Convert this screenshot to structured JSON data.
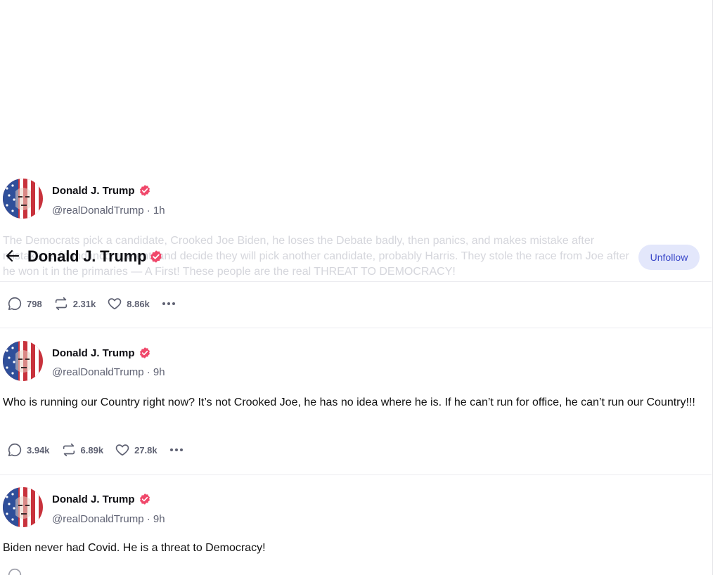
{
  "header": {
    "title": "Donald J. Trump",
    "unfollow_label": "Unfollow"
  },
  "posts": [
    {
      "author": "Donald J. Trump",
      "handle": "@realDonaldTrump",
      "time": "1h",
      "text_lines": [
        "The Democrats pick a candidate, Crooked Joe Biden, he loses the Debate badly, then panics, and makes mistake after",
        "mistake, is found incompetent, and decide they will pick another candidate, probably Harris. They stole the race from Joe after",
        "he won it in the primaries — A First! These people are the real THREAT TO DEMOCRACY!"
      ],
      "replies": "798",
      "reposts": "2.31k",
      "likes": "8.86k"
    },
    {
      "author": "Donald J. Trump",
      "handle": "@realDonaldTrump",
      "time": "9h",
      "text": "Who is running our Country right now? It’s not Crooked Joe, he has no idea where he is. If he can’t run for office, he can’t run our Country!!!",
      "replies": "3.94k",
      "reposts": "6.89k",
      "likes": "27.8k"
    },
    {
      "author": "Donald J. Trump",
      "handle": "@realDonaldTrump",
      "time": "9h",
      "text": "Biden never had Covid. He is a threat to Democracy!"
    }
  ],
  "colors": {
    "verified": "#f0476a",
    "unfollow_bg": "#e3e7fb",
    "unfollow_text": "#3a47c9",
    "muted": "#5e6172"
  }
}
